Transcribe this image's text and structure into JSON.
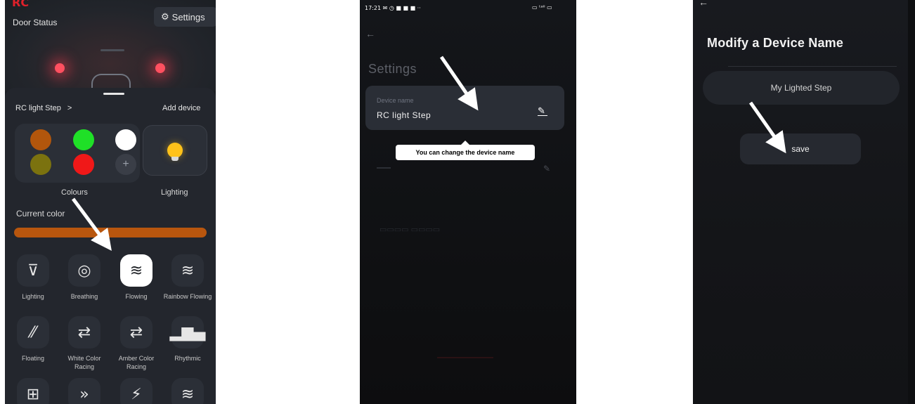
{
  "screen1": {
    "brand": "RC",
    "door_status": "Door Status",
    "settings_label": "Settings",
    "device_name": "RC light Step",
    "device_chevron": ">",
    "add_device": "Add device",
    "swatch_colors": [
      "#b2560c",
      "#1fe027",
      "#ffffff",
      "#7b720f",
      "#f01818"
    ],
    "plus_symbol": "+",
    "colours_label": "Colours",
    "lighting_label": "Lighting",
    "current_color_label": "Current color",
    "current_color_value": "#b8560e",
    "modes": [
      {
        "icon": "flashlight-icon",
        "glyph": "⊽",
        "label": "Lighting"
      },
      {
        "icon": "breathing-icon",
        "glyph": "◎",
        "label": "Breathing"
      },
      {
        "icon": "flowing-icon",
        "glyph": "≋",
        "label": "Flowing",
        "active": true
      },
      {
        "icon": "rainbow-flowing-icon",
        "glyph": "≋",
        "label": "Rainbow Flowing"
      },
      {
        "icon": "floating-icon",
        "glyph": "⁄⁄",
        "label": "Floating"
      },
      {
        "icon": "white-racing-icon",
        "glyph": "⇄",
        "label": "White Color Racing"
      },
      {
        "icon": "amber-racing-icon",
        "glyph": "⇄",
        "label": "Amber Color Racing"
      },
      {
        "icon": "rhythmic-icon",
        "glyph": "▂▆▄",
        "label": "Rhythmic"
      },
      {
        "icon": "diagram-icon",
        "glyph": "⊞",
        "label": ""
      },
      {
        "icon": "chevrons-icon",
        "glyph": "»",
        "label": ""
      },
      {
        "icon": "flash-icon",
        "glyph": "⚡",
        "label": ""
      },
      {
        "icon": "waves-icon",
        "glyph": "≋",
        "label": ""
      }
    ]
  },
  "screen2": {
    "status_left": "17:21 ✉ ◷ ■ ■ ■ ·· ",
    "status_right": "▭ ᵗᵃᴵᴵ ▭",
    "title": "Settings",
    "device_name_caption": "Device name",
    "device_name_value": "RC light Step",
    "tooltip": "You can change the device name"
  },
  "screen3": {
    "title": "Modify a Device Name",
    "input_value": "My Lighted Step",
    "save_label": "save"
  }
}
